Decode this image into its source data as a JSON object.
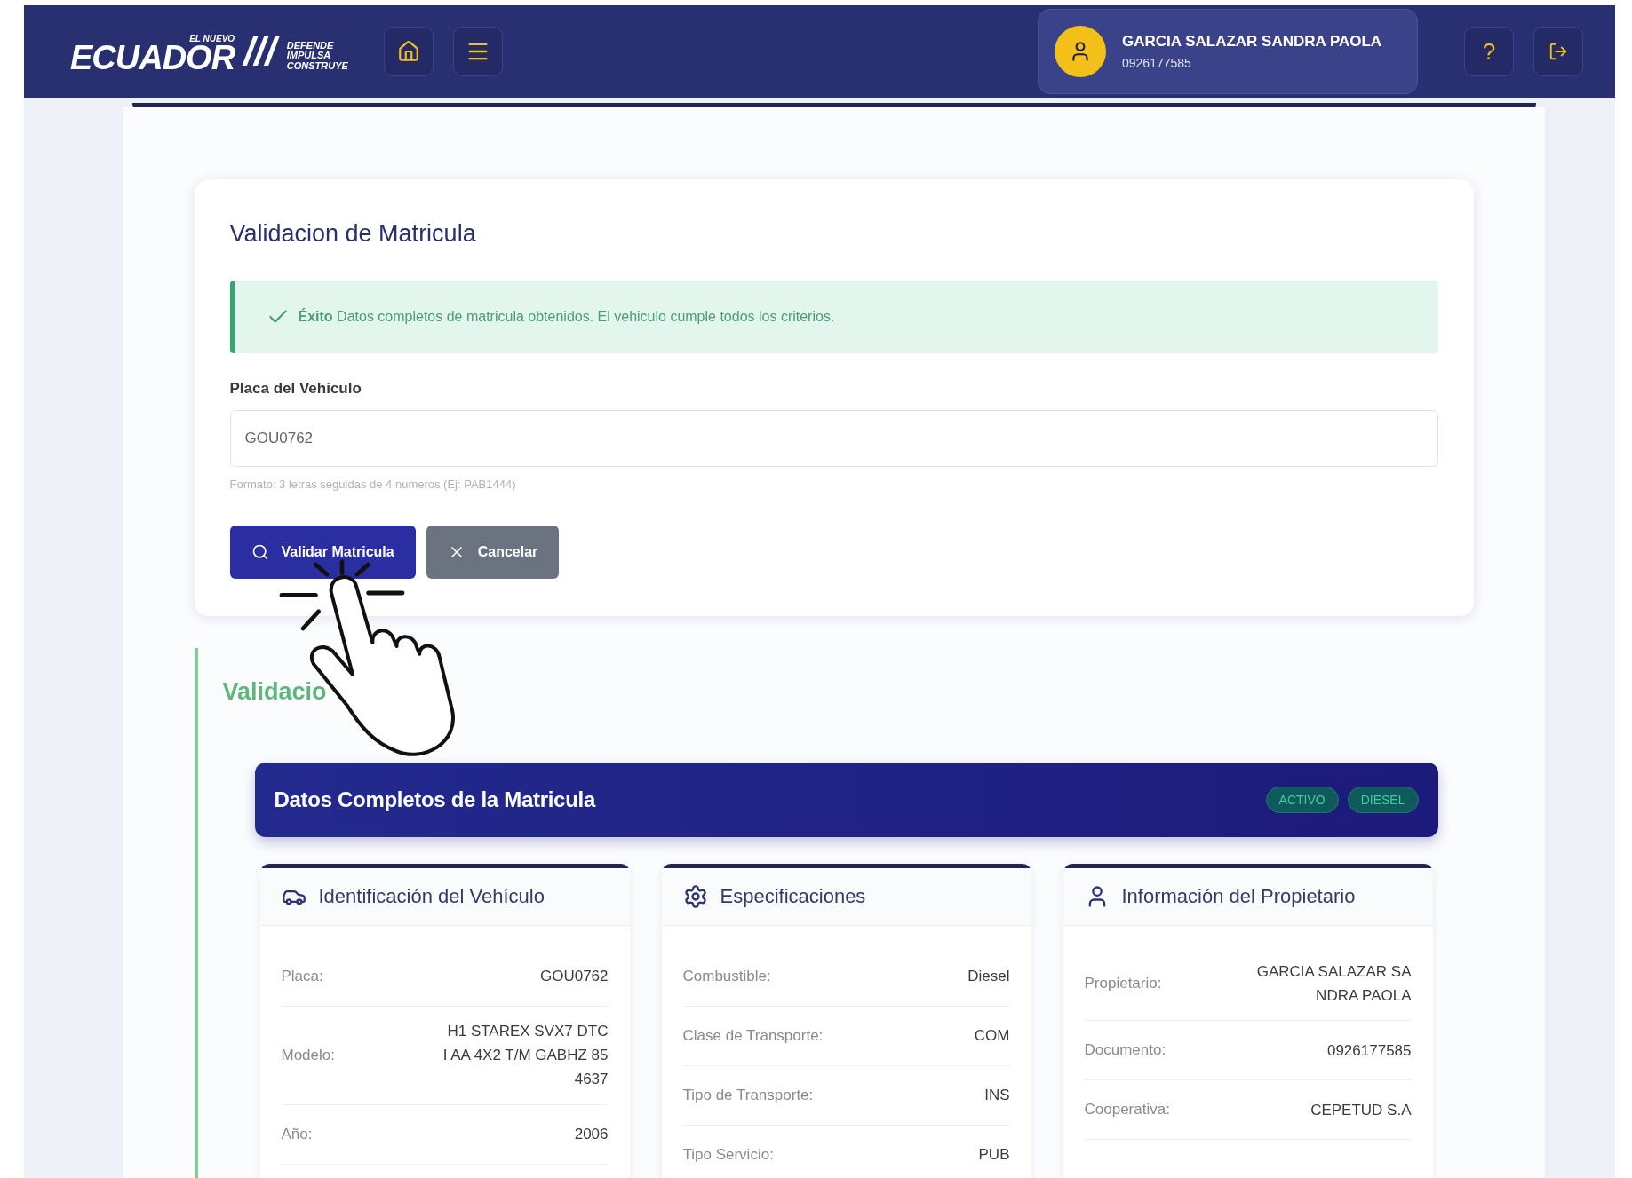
{
  "header": {
    "logo": {
      "overline": "EL NUEVO",
      "main": "ECUADOR",
      "slashes": "///",
      "tagline": [
        "DEFENDE",
        "IMPULSA",
        "CONSTRUYE"
      ]
    },
    "user": {
      "name": "GARCIA SALAZAR SANDRA PAOLA",
      "id": "0926177585"
    },
    "help_button": "?"
  },
  "validation_form": {
    "title": "Validacion de Matricula",
    "alert": {
      "kind": "success",
      "title": "Éxito",
      "message": "Datos completos de matricula obtenidos. El vehiculo cumple todos los criterios."
    },
    "field": {
      "label": "Placa del Vehiculo",
      "value": "GOU0762",
      "hint": "Formato: 3 letras seguidas de 4 numeros (Ej: PAB1444)"
    },
    "buttons": [
      {
        "kind": "primary",
        "label": "Validar Matricula"
      },
      {
        "kind": "secondary",
        "label": "Cancelar"
      }
    ]
  },
  "result": {
    "heading": "Validacio",
    "banner": {
      "title": "Datos Completos de la Matricula",
      "badges": [
        "ACTIVO",
        "DIESEL"
      ]
    },
    "cards": [
      {
        "title": "Identificación del Vehículo",
        "rows": [
          {
            "label": "Placa:",
            "value": "GOU0762"
          },
          {
            "label": "Modelo:",
            "value": "H1 STAREX SVX7 DTC I AA 4X2 T/M GABHZ 85 4637"
          },
          {
            "label": "Año:",
            "value": "2006"
          }
        ]
      },
      {
        "title": "Especificaciones",
        "rows": [
          {
            "label": "Combustible:",
            "value": "Diesel"
          },
          {
            "label": "Clase de Transporte:",
            "value": "COM"
          },
          {
            "label": "Tipo de Transporte:",
            "value": "INS"
          },
          {
            "label": "Tipo Servicio:",
            "value": "PUB"
          }
        ]
      },
      {
        "title": "Información del Propietario",
        "rows": [
          {
            "label": "Propietario:",
            "value": "GARCIA SALAZAR SA NDRA PAOLA"
          },
          {
            "label": "Documento:",
            "value": "0926177585"
          },
          {
            "label": "Cooperativa:",
            "value": "CEPETUD S.A"
          }
        ]
      }
    ]
  }
}
